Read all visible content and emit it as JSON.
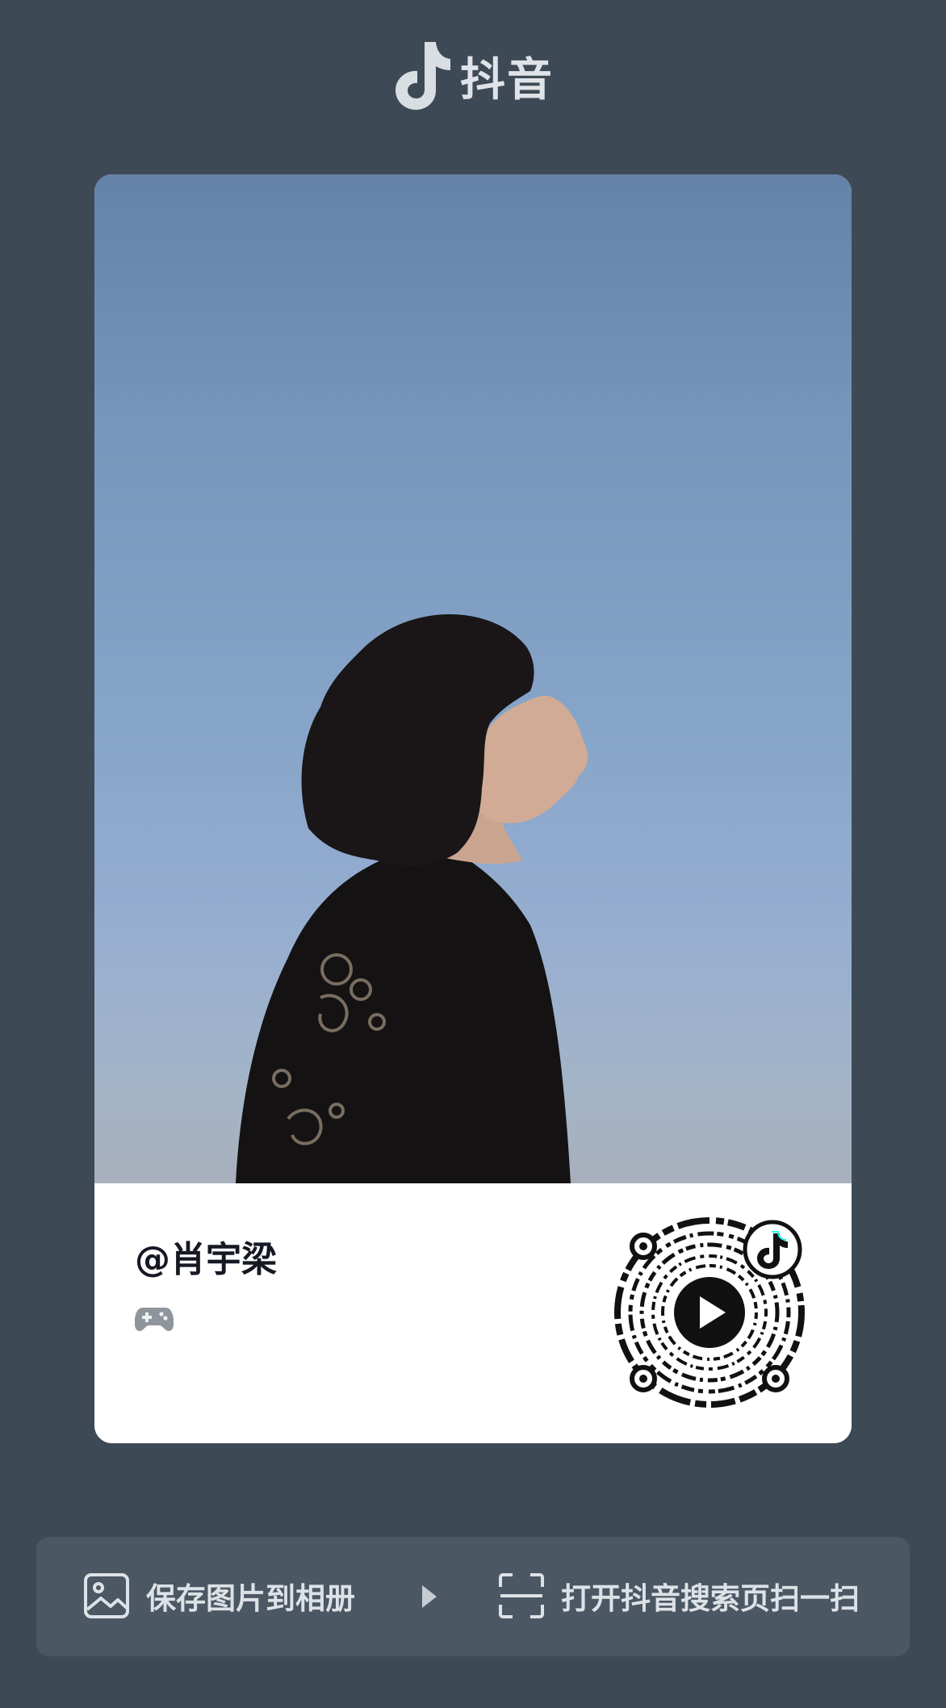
{
  "brand": {
    "name": "抖音",
    "icon": "douyin-logo-icon"
  },
  "card": {
    "username": "@肖宇梁",
    "badge_icon": "gamepad-icon",
    "qr_icon": "qr-code-icon",
    "qr_center_icon": "play-icon",
    "qr_corner_icon": "douyin-logo-icon"
  },
  "actions": {
    "save_label": "保存图片到相册",
    "save_icon": "image-icon",
    "separator_icon": "triangle-right-icon",
    "scan_label": "打开抖音搜索页扫一扫",
    "scan_icon": "scan-icon"
  },
  "colors": {
    "background": "#3d4a56",
    "action_bar": "#4b5763",
    "card": "#ffffff",
    "username": "#161823"
  }
}
